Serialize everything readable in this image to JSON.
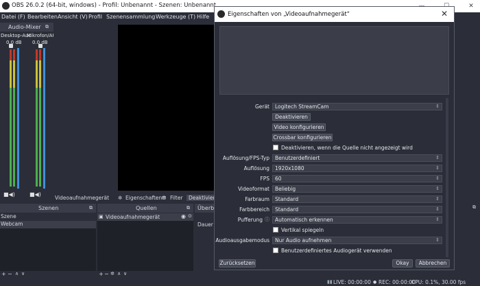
{
  "window": {
    "title": "OBS 26.0.2 (64-bit, windows) - Profil: Unbenannt - Szenen: Unbenannt",
    "minimize": "—",
    "maximize": "☐",
    "close": "✕"
  },
  "menu": [
    "Datei (F)",
    "Bearbeiten",
    "Ansicht (V)",
    "Profil",
    "Szenensammlung",
    "Werkzeuge (T)",
    "Hilfe"
  ],
  "mixer": {
    "title": "Audio-Mixer",
    "channels": [
      {
        "name": "Desktop-Auc",
        "db": "0.0 dB"
      },
      {
        "name": "Mikrofon/AU",
        "db": "0.0 dB"
      }
    ]
  },
  "source_toolbar": {
    "source_name": "Videoaufnahmegerät",
    "properties": "Eigenschaften",
    "filter": "Filter",
    "deactivate": "Deaktivieren"
  },
  "scenes": {
    "title": "Szenen",
    "header": "Szene",
    "items": [
      "Webcam"
    ]
  },
  "sources": {
    "title": "Quellen",
    "items": [
      "Videoaufnahmegerät"
    ]
  },
  "transitions": {
    "header": "Überb",
    "duration_label": "Dauer"
  },
  "status": {
    "live": "LIVE: 00:00:00",
    "rec": "REC: 00:00:00",
    "cpu": "CPU: 0.1%, 30.00 fps"
  },
  "dialog": {
    "title": "Eigenschaften von „Videoaufnahmegerät“",
    "close": "✕",
    "device_label": "Gerät",
    "device_value": "Logitech StreamCam",
    "btn_deactivate": "Deaktivieren",
    "btn_configure_video": "Video konfigurieren",
    "btn_configure_crossbar": "Crossbar konfigurieren",
    "check_deactivate_hidden": "Deaktivieren, wenn die Quelle nicht angezeigt wird",
    "fields": [
      {
        "label": "Auflösung/FPS-Typ",
        "value": "Benutzerdefiniert"
      },
      {
        "label": "Auflösung",
        "value": "1920x1080"
      },
      {
        "label": "FPS",
        "value": "60"
      },
      {
        "label": "Videoformat",
        "value": "Beliebig"
      },
      {
        "label": "Farbraum",
        "value": "Standard"
      },
      {
        "label": "Farbbereich",
        "value": "Standard"
      },
      {
        "label": "Pufferung",
        "value": "Automatisch erkennen"
      }
    ],
    "check_flip": "Vertikal spiegeln",
    "audio_output_label": "Audioausgabemodus",
    "audio_output_value": "Nur Audio aufnehmen",
    "check_custom_audio": "Benutzerdefiniertes Audiogerät verwenden",
    "btn_defaults": "Zurücksetzen",
    "btn_ok": "Okay",
    "btn_cancel": "Abbrechen"
  },
  "colors": {
    "accent": "#4090d8",
    "background": "#2b2e38",
    "meter_green": "#4caf50",
    "meter_yellow": "#c9c23a",
    "meter_red": "#c0392b"
  }
}
